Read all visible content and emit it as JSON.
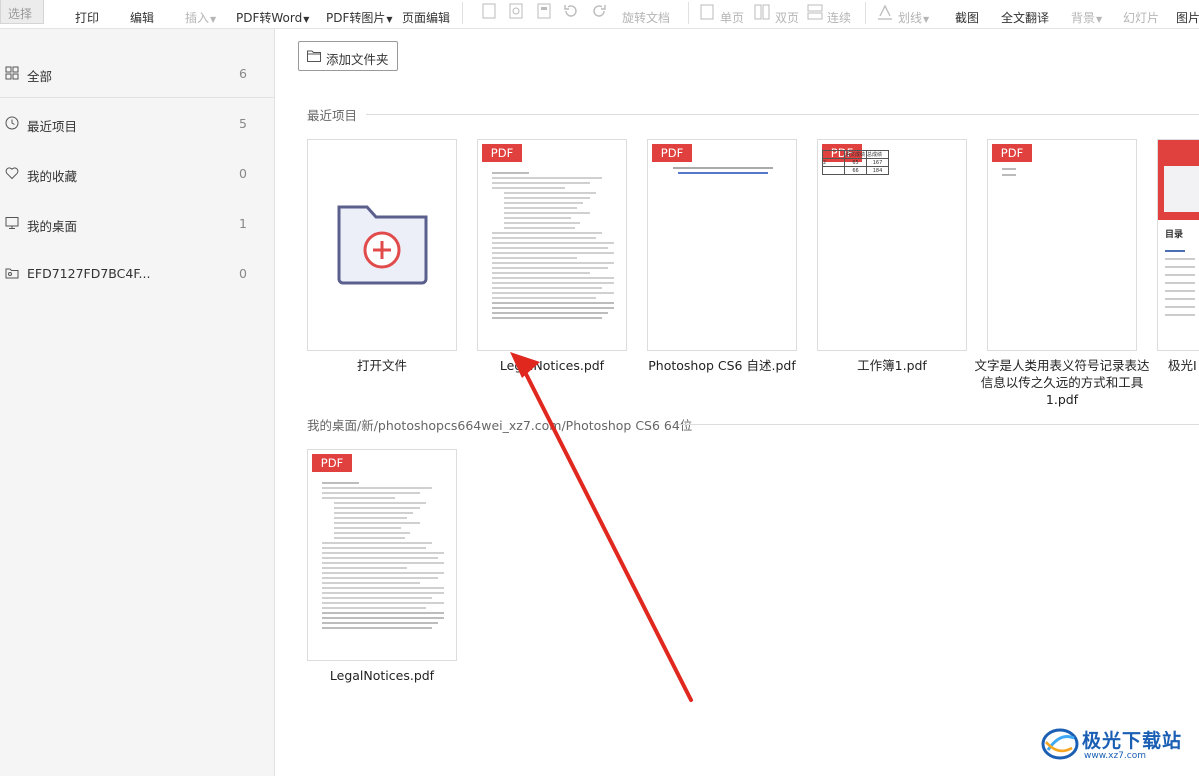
{
  "toolbar": {
    "select": "选择",
    "print": "打印",
    "edit": "编辑",
    "insert": "插入",
    "pdf_to_word": "PDF转Word",
    "pdf_to_image": "PDF转图片",
    "page_edit": "页面编辑",
    "rotate_doc": "旋转文档",
    "single_page": "单页",
    "double_page": "双页",
    "continuous": "连续",
    "underline": "划线",
    "screenshot": "截图",
    "full_translate": "全文翻译",
    "background": "背景",
    "slideshow": "幻灯片",
    "image": "图片"
  },
  "sidebar": {
    "items": [
      {
        "label": "全部",
        "count": "6",
        "icon": "grid-icon"
      },
      {
        "label": "最近项目",
        "count": "5",
        "icon": "clock-icon"
      },
      {
        "label": "我的收藏",
        "count": "0",
        "icon": "heart-icon"
      },
      {
        "label": "我的桌面",
        "count": "1",
        "icon": "monitor-icon"
      },
      {
        "label": "EFD7127FD7BC4F...",
        "count": "0",
        "icon": "folder-icon"
      }
    ]
  },
  "main": {
    "add_folder": "添加文件夹",
    "recent_title": "最近项目",
    "path_title": "我的桌面/新/photoshopcs664wei_xz7.com/Photoshop CS6 64位",
    "pdf_badge": "PDF",
    "recent_files": [
      {
        "name": "打开文件"
      },
      {
        "name": "LegalNotices.pdf"
      },
      {
        "name": "Photoshop CS6 自述.pdf"
      },
      {
        "name": "工作簿1.pdf"
      },
      {
        "name": "文字是人类用表义符号记录表达信息以传之久远的方式和工具 1.pdf"
      },
      {
        "name": "极光I"
      }
    ],
    "desktop_files": [
      {
        "name": "LegalNotices.pdf"
      }
    ],
    "mini_table": {
      "headers": [
        "",
        "语文成绩",
        "总成绩"
      ],
      "rows": [
        [
          "",
          "65",
          "167"
        ],
        [
          "",
          "66",
          "184"
        ]
      ],
      "row_label": "2"
    },
    "slide_heading": "目录"
  },
  "watermark": {
    "title": "极光下载站",
    "url": "www.xz7.com"
  },
  "colors": {
    "pdf_red": "#e0413f",
    "arrow_red": "#e0281e",
    "folder_purple": "#5a5f8c"
  }
}
